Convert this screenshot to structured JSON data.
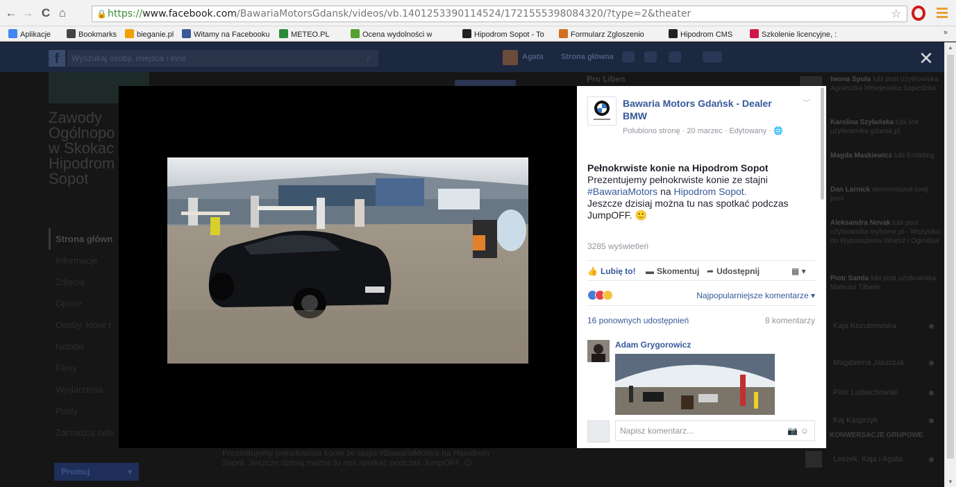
{
  "browser": {
    "url_scheme": "https://",
    "url_host": "www.facebook.com",
    "url_path": "/BawariaMotorsGdansk/videos/vb.1401253390114524/1721555398084320/?type=2&theater",
    "bookmarks": [
      {
        "label": "Aplikacje",
        "color": "#4285f4"
      },
      {
        "label": "Bookmarks",
        "color": "#444444"
      },
      {
        "label": "bieganie.pl",
        "color": "#f0a000"
      },
      {
        "label": "Witamy na Facebooku",
        "color": "#3b5998"
      },
      {
        "label": "METEO.PL",
        "color": "#2a8a3a"
      },
      {
        "label": "Ocena wydolności w",
        "color": "#55a030"
      },
      {
        "label": "Hipodrom Sopot - To",
        "color": "#222222"
      },
      {
        "label": "Formularz Zgloszenio",
        "color": "#d07020"
      },
      {
        "label": "Hipodrom CMS",
        "color": "#222222"
      },
      {
        "label": "Szkolenie licencyjne, :",
        "color": "#d01848"
      }
    ],
    "bookmarks_more": "»"
  },
  "fb": {
    "search_placeholder": "Wyszukaj osoby, miejsca i inne",
    "top_links": [
      "Agata",
      "Strona główna"
    ],
    "page_title": "Zawody Ogólnopo w Skokac Hipodrom Sopot",
    "left_nav": [
      "Strona główn",
      "Informacje",
      "Zdjęcia",
      "Opinie",
      "Osoby, które t",
      "Notatki",
      "Filmy",
      "Wydarzenia",
      "Posty",
      "Zarządzaj selu"
    ],
    "promote_label": "Promuj",
    "pro_label": "Pro Liben",
    "bottom_text": "Prezentujemy pełnokrwiste konie ze stajni #BawariaMotors na Hipodrom Sopot. Jeszcze dzisiaj można tu nas spotkać podczas JumpOFF. 😉",
    "ticker": [
      {
        "name": "Iwona Spula",
        "text": "lubi post użytkownika Agnieszka Weiejewska Sapiedzka"
      },
      {
        "name": "Karolina Szyłańska",
        "text": "lubi link użytkownika gdansk.pl"
      },
      {
        "name": "Magda Maskiewicz",
        "text": "lubi Erotiding"
      },
      {
        "name": "Dan Larnick",
        "text": "skomentował swój post"
      },
      {
        "name": "Aleksandra Novak",
        "text": "lubi post użytkownika myhome.pl - Wszystko do Wyposażenia Wnętrz i Ogrodów"
      },
      {
        "name": "Piotr Samla",
        "text": "lubi post użytkownika Mateusz Tilberki"
      }
    ],
    "chat": [
      "Kaja Kozubrowska",
      "Magdalena Jaszczak",
      "Piotr Ludwichowski",
      "Kaj Kasprzyk"
    ],
    "chat_header": "KONWERSACJE GRUPOWE",
    "chat_group": "Leszek, Kaja i Agata"
  },
  "post": {
    "page_name": "Bawaria Motors Gdańsk - Dealer BMW",
    "meta": "Polubiono stronę · 20 marzec · Edytowany · ",
    "headline": "Pełnokrwiste konie na Hipodrom Sopot",
    "body_1": "Prezentujemy pełnokrwiste konie ze stajni ",
    "hashtag": "#BawariaMotors",
    "body_2": " na ",
    "place_link": "Hipodrom Sopot.",
    "body_3": "Jeszcze dzisiaj można tu nas spotkać podczas JumpOFF. 🙂",
    "views": "3285 wyświetleń",
    "like_label": "Lubię to!",
    "comment_label": "Skomentuj",
    "share_label": "Udostępnij",
    "sort_label": "Najpopularniejsze komentarze ▾",
    "shares_count": "16 ponownych udostępnień",
    "comments_count": "8 komentarzy",
    "commenter_name": "Adam Grygorowicz",
    "comment_placeholder": "Napisz komentarz..."
  },
  "colors": {
    "fb_blue": "#365899",
    "like_reaction": "#4a7ed6",
    "love_reaction": "#e8404e",
    "wow_reaction": "#f5c33b"
  }
}
